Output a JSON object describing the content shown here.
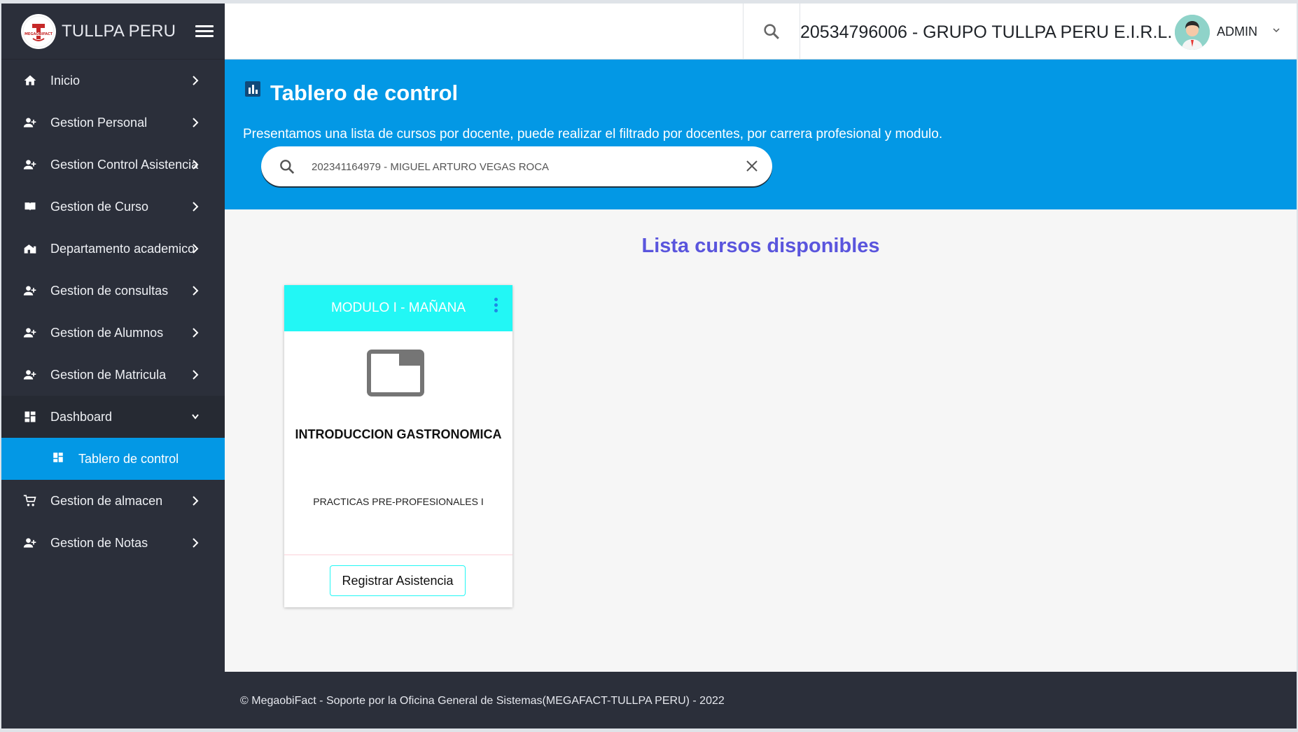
{
  "brand": {
    "name": "TULLPA PERU",
    "logo_text": "MEGAOBIFACT"
  },
  "header": {
    "company": "20534796006 - GRUPO TULLPA PERU E.I.R.L.",
    "user": "ADMIN"
  },
  "sidebar": {
    "items": [
      {
        "label": "Inicio",
        "icon": "home-icon"
      },
      {
        "label": "Gestion Personal",
        "icon": "person-add-icon"
      },
      {
        "label": "Gestion Control Asistencia",
        "icon": "person-add-icon"
      },
      {
        "label": "Gestion de Curso",
        "icon": "book-icon"
      },
      {
        "label": "Departamento academico",
        "icon": "building-icon"
      },
      {
        "label": "Gestion de consultas",
        "icon": "person-add-icon"
      },
      {
        "label": "Gestion de Alumnos",
        "icon": "person-add-icon"
      },
      {
        "label": "Gestion de Matricula",
        "icon": "person-add-icon"
      },
      {
        "label": "Dashboard",
        "icon": "dashboard-icon"
      },
      {
        "label": "Tablero de control",
        "icon": "dashboard-icon"
      },
      {
        "label": "Gestion de almacen",
        "icon": "cart-icon"
      },
      {
        "label": "Gestion de Notas",
        "icon": "person-add-icon"
      }
    ]
  },
  "banner": {
    "title": "Tablero de control",
    "description": "Presentamos una lista de cursos por docente, puede realizar el filtrado por docentes, por carrera profesional y modulo.",
    "search_value": "202341164979 - MIGUEL ARTURO VEGAS ROCA"
  },
  "content": {
    "section_title": "Lista cursos disponibles",
    "card": {
      "module": "MODULO I - MAÑANA",
      "course": "INTRODUCCION GASTRONOMICA",
      "subtitle": "PRACTICAS PRE-PROFESIONALES I",
      "button": "Registrar Asistencia"
    }
  },
  "footer": {
    "text": "© MegaobiFact - Soporte por la Oficina General de Sistemas(MEGAFACT-TULLPA PERU) - 2022"
  },
  "colors": {
    "sidebar_bg": "#2b2f3a",
    "accent_blue": "#0398e5",
    "card_header": "#22f7f5",
    "section_title": "#5a55dd"
  }
}
